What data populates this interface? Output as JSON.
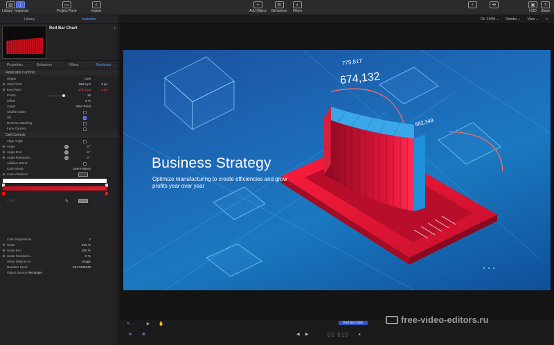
{
  "toolbar": {
    "library": "Library",
    "inspector": "Inspector",
    "project_pane": "Project Pane",
    "import": "Import",
    "add_object": "Add Object",
    "behaviors": "Behaviors",
    "filters": "Filters",
    "hud": "HUD",
    "share": "Share"
  },
  "left_tabs": {
    "library": "Library",
    "inspector": "Inspector"
  },
  "preview": {
    "title": "Red Bar Chart"
  },
  "inspector_tabs": [
    "Properties",
    "Behaviors",
    "Filters",
    "Replicator"
  ],
  "replicator_controls": {
    "heading": "Replicator Controls",
    "shape": {
      "label": "Shape",
      "value": "Line"
    },
    "start_point": {
      "label": "Start Point",
      "x": "-188.5 px",
      "y": "5 px"
    },
    "end_point": {
      "label": "End Point",
      "x": "272.1 px",
      "y": "1 px"
    },
    "points": {
      "label": "Points",
      "value": "19"
    },
    "offset": {
      "label": "Offset",
      "value": "3 %"
    },
    "origin": {
      "label": "Origin",
      "value": "Start Point"
    },
    "shuffle_order": "Shuffle Order",
    "three_d": "3D",
    "reverse_stacking": "Reverse Stacking",
    "face_camera": "Face Camera"
  },
  "cell_controls": {
    "heading": "Cell Controls",
    "align_angle": "Align Angle",
    "angle": {
      "label": "Angle",
      "value": "3 °"
    },
    "angle_end": {
      "label": "Angle End",
      "value": "3 °"
    },
    "angle_randomness": {
      "label": "Angle Randomn...",
      "value": "0 °"
    },
    "additive_blend": "Additive Blend",
    "color_mode": {
      "label": "Color Mode",
      "value": "Over Pattern"
    },
    "color_gradient": "Color Gradient",
    "color": "Color",
    "cell_repetitions": {
      "label": "Color Repetitions",
      "value": "3"
    },
    "scale": {
      "label": "Scale",
      "value": "100 %"
    },
    "scale_end": {
      "label": "Scale End",
      "value": "100 %"
    },
    "scale_randomness": {
      "label": "Scale Randomn...",
      "value": "0 %"
    },
    "show_objects_as": {
      "label": "Show Objects As",
      "value": "Image"
    },
    "random_seed": {
      "label": "Random Seed",
      "value": "-2147483648"
    },
    "object_source": {
      "label": "Object Source",
      "value": "Rectangle"
    }
  },
  "viewer": {
    "fit": "Fit: 144% ⌄",
    "render": "Render ⌄",
    "view": "View ⌄"
  },
  "canvas": {
    "headline": "Business Strategy",
    "subtitle": "Optimize manufacturing to create efficiencies and grow profits year over year",
    "stat1": "779,817",
    "stat2": "674,132",
    "stat3": "582,349"
  },
  "timeline": {
    "clip_label": "Red Bar Chart",
    "timecode": "00 815"
  },
  "watermark": "free-video-editors.ru"
}
